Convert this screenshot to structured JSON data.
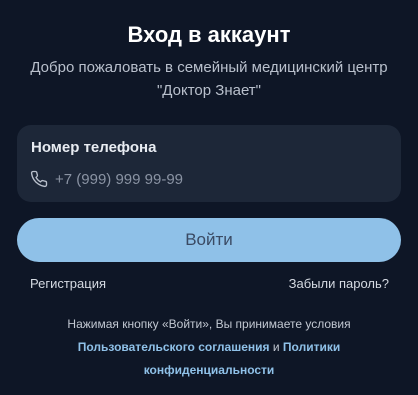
{
  "header": {
    "title": "Вход в аккаунт",
    "subtitle": "Добро пожаловать в семейный медицинский центр \"Доктор Знает\""
  },
  "phone_field": {
    "label": "Номер телефона",
    "placeholder": "+7 (999) 999 99-99",
    "value": "",
    "icon": "phone-icon"
  },
  "login_button": {
    "label": "Войти"
  },
  "links": {
    "register": "Регистрация",
    "forgot_password": "Забыли пароль?"
  },
  "terms": {
    "prefix": "Нажимая кнопку «Войти», Вы принимаете условия",
    "user_agreement": "Пользовательского соглашения",
    "conjunction": "и",
    "privacy_policy": "Политики конфиденциальности"
  },
  "colors": {
    "background": "#0e1626",
    "card": "#1d2738",
    "accent": "#8fc1e8",
    "button_text": "#3a4a63",
    "link_accent": "#8fc1e8"
  }
}
